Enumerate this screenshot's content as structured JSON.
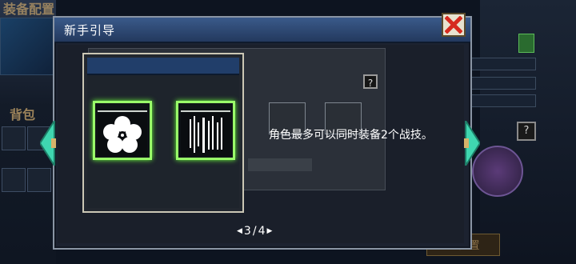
{
  "background": {
    "left_title": "装备配置",
    "bag_label": "背包",
    "question_mark": "?",
    "right_button_label": "技配置"
  },
  "dialog": {
    "title": "新手引导",
    "close_icon": "close-x-icon",
    "question_mark": "?",
    "hint_text": "角色最多可以同时装备2个战技。",
    "pager": {
      "prev_icon": "triangle-left-icon",
      "current": "3",
      "separator": "/",
      "total": "4",
      "next_icon": "triangle-right-icon"
    }
  },
  "colors": {
    "header_blue": "#2c4a78",
    "highlight_green": "#9aff6a",
    "arrow_teal": "#3fd6b0"
  }
}
